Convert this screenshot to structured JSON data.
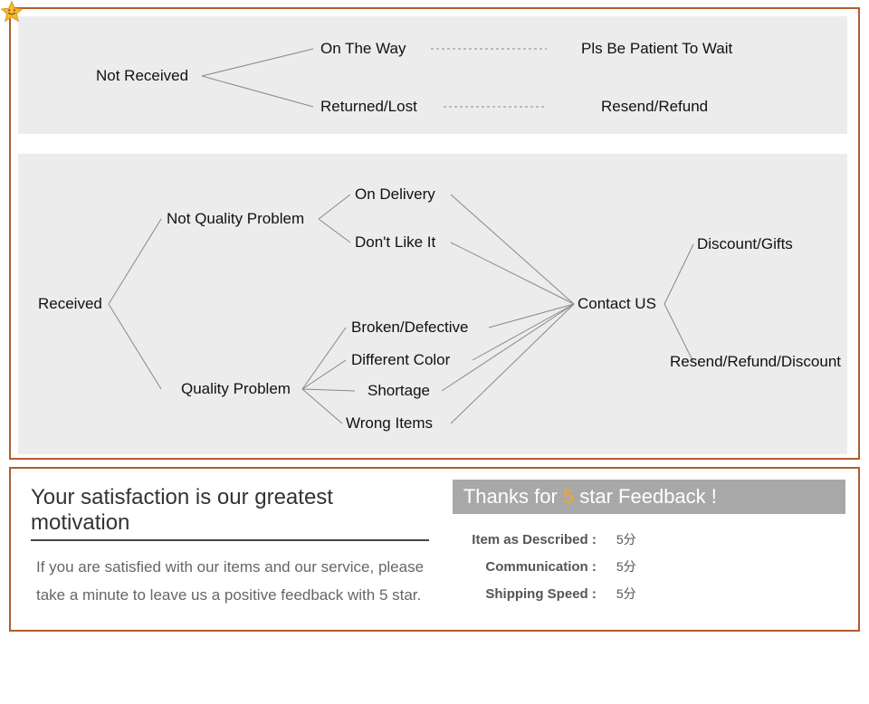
{
  "tree1": {
    "root": "Not Received",
    "branches": [
      {
        "mid": "On The Way",
        "end": "Pls Be Patient To Wait"
      },
      {
        "mid": "Returned/Lost",
        "end": "Resend/Refund"
      }
    ]
  },
  "tree2": {
    "root": "Received",
    "branch_a": {
      "label": "Not Quality Problem",
      "items": [
        "On Delivery",
        "Don't Like It"
      ]
    },
    "branch_b": {
      "label": "Quality Problem",
      "items": [
        "Broken/Defective",
        "Different Color",
        "Shortage",
        "Wrong Items"
      ]
    },
    "hub": "Contact US",
    "outcomes": [
      "Discount/Gifts",
      "Resend/Refund/Discount"
    ]
  },
  "feedback": {
    "heading": "Your satisfaction is our greatest motivation",
    "body": "If you are satisfied with our items and our service, please take a minute to leave us a positive feedback with 5 star.",
    "thanks_prefix": "Thanks for ",
    "thanks_five": "5",
    "thanks_suffix": " star Feedback !",
    "ratings": [
      {
        "label": "Item as Described :",
        "score": "5分"
      },
      {
        "label": "Communication :",
        "score": "5分"
      },
      {
        "label": "Shipping Speed :",
        "score": "5分"
      }
    ]
  }
}
